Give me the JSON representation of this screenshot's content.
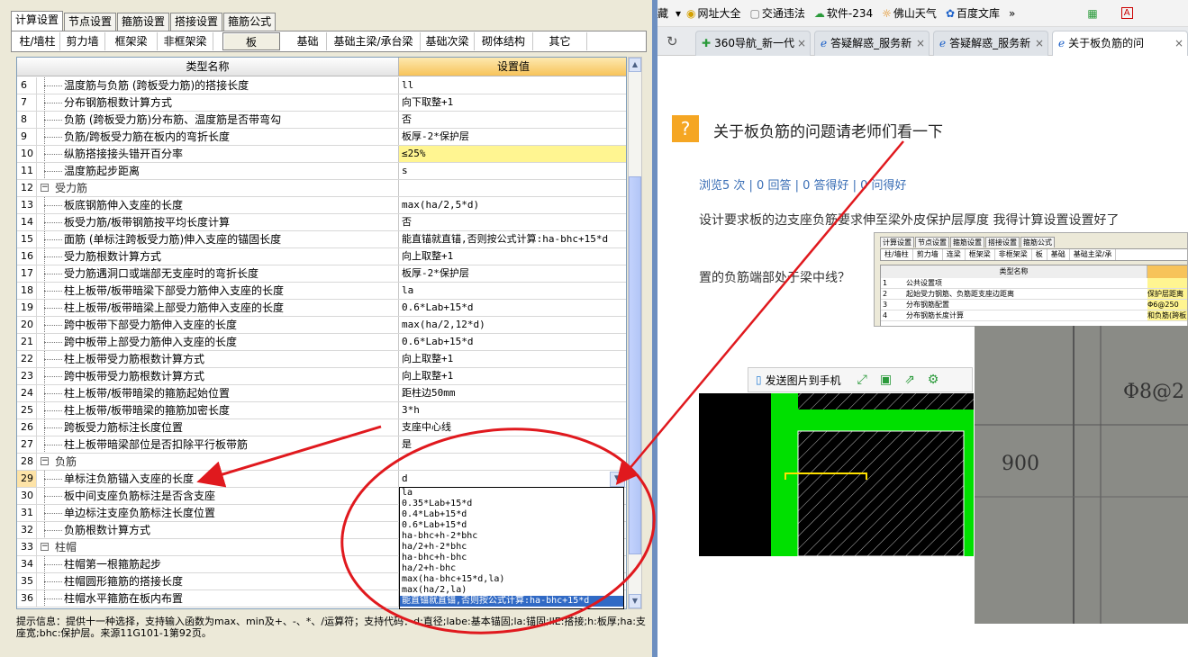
{
  "left_app": {
    "top_tabs": [
      "计算设置",
      "节点设置",
      "箍筋设置",
      "搭接设置",
      "箍筋公式"
    ],
    "top_tab_active": 0,
    "sub_tabs": [
      "柱/墙柱",
      "剪力墙",
      "框架梁",
      "非框架梁",
      "板",
      "基础",
      "基础主梁/承台梁",
      "基础次梁",
      "砌体结构",
      "其它"
    ],
    "sub_tab_active": 4,
    "grid": {
      "header_name": "类型名称",
      "header_value": "设置值",
      "rows": [
        {
          "n": "6",
          "name": "温度筋与负筋 (跨板受力筋)的搭接长度",
          "value": "ll",
          "type": "item"
        },
        {
          "n": "7",
          "name": "分布钢筋根数计算方式",
          "value": "向下取整+1",
          "type": "item"
        },
        {
          "n": "8",
          "name": "负筋 (跨板受力筋)分布筋、温度筋是否带弯勾",
          "value": "否",
          "type": "item"
        },
        {
          "n": "9",
          "name": "负筋/跨板受力筋在板内的弯折长度",
          "value": "板厚-2*保护层",
          "type": "item"
        },
        {
          "n": "10",
          "name": "纵筋搭接接头错开百分率",
          "value": "≤25%",
          "type": "item",
          "highlight": true
        },
        {
          "n": "11",
          "name": "温度筋起步距离",
          "value": "s",
          "type": "item"
        },
        {
          "n": "12",
          "name": "受力筋",
          "value": "",
          "type": "group"
        },
        {
          "n": "13",
          "name": "板底钢筋伸入支座的长度",
          "value": "max(ha/2,5*d)",
          "type": "item"
        },
        {
          "n": "14",
          "name": "板受力筋/板带钢筋按平均长度计算",
          "value": "否",
          "type": "item"
        },
        {
          "n": "15",
          "name": "面筋 (单标注跨板受力筋)伸入支座的锚固长度",
          "value": "能直锚就直锚,否则按公式计算:ha-bhc+15*d",
          "type": "item"
        },
        {
          "n": "16",
          "name": "受力筋根数计算方式",
          "value": "向上取整+1",
          "type": "item"
        },
        {
          "n": "17",
          "name": "受力筋遇洞口或端部无支座时的弯折长度",
          "value": "板厚-2*保护层",
          "type": "item"
        },
        {
          "n": "18",
          "name": "柱上板带/板带暗梁下部受力筋伸入支座的长度",
          "value": "la",
          "type": "item"
        },
        {
          "n": "19",
          "name": "柱上板带/板带暗梁上部受力筋伸入支座的长度",
          "value": "0.6*Lab+15*d",
          "type": "item"
        },
        {
          "n": "20",
          "name": "跨中板带下部受力筋伸入支座的长度",
          "value": "max(ha/2,12*d)",
          "type": "item"
        },
        {
          "n": "21",
          "name": "跨中板带上部受力筋伸入支座的长度",
          "value": "0.6*Lab+15*d",
          "type": "item"
        },
        {
          "n": "22",
          "name": "柱上板带受力筋根数计算方式",
          "value": "向上取整+1",
          "type": "item"
        },
        {
          "n": "23",
          "name": "跨中板带受力筋根数计算方式",
          "value": "向上取整+1",
          "type": "item"
        },
        {
          "n": "24",
          "name": "柱上板带/板带暗梁的箍筋起始位置",
          "value": "距柱边50mm",
          "type": "item"
        },
        {
          "n": "25",
          "name": "柱上板带/板带暗梁的箍筋加密长度",
          "value": "3*h",
          "type": "item"
        },
        {
          "n": "26",
          "name": "跨板受力筋标注长度位置",
          "value": "支座中心线",
          "type": "item"
        },
        {
          "n": "27",
          "name": "柱上板带暗梁部位是否扣除平行板带筋",
          "value": "是",
          "type": "item"
        },
        {
          "n": "28",
          "name": "负筋",
          "value": "",
          "type": "group"
        },
        {
          "n": "29",
          "name": "单标注负筋锚入支座的长度",
          "value": "d",
          "type": "item",
          "selected": true
        },
        {
          "n": "30",
          "name": "板中间支座负筋标注是否含支座",
          "value": "",
          "type": "item"
        },
        {
          "n": "31",
          "name": "单边标注支座负筋标注长度位置",
          "value": "",
          "type": "item"
        },
        {
          "n": "32",
          "name": "负筋根数计算方式",
          "value": "",
          "type": "item"
        },
        {
          "n": "33",
          "name": "柱帽",
          "value": "",
          "type": "group"
        },
        {
          "n": "34",
          "name": "柱帽第一根箍筋起步",
          "value": "",
          "type": "item"
        },
        {
          "n": "35",
          "name": "柱帽圆形箍筋的搭接长度",
          "value": "",
          "type": "item"
        },
        {
          "n": "36",
          "name": "柱帽水平箍筋在板内布置",
          "value": "",
          "type": "item"
        }
      ]
    },
    "dropdown_options": [
      "la",
      "0.35*Lab+15*d",
      "0.4*Lab+15*d",
      "0.6*Lab+15*d",
      "ha-bhc+h-2*bhc",
      "ha/2+h-2*bhc",
      "ha-bhc+h-bhc",
      "ha/2+h-bhc",
      "max(ha-bhc+15*d,la)",
      "max(ha/2,la)",
      "能直锚就直锚,否则按公式计算:ha-bhc+15*d"
    ],
    "dropdown_selected": 10,
    "hint": "提示信息：提供十一种选择，支持输入函数为max、min及+、-、*、/运算符；支持代码：d:直径;labe:基本锚固;la:锚固;llE:搭接;h:板厚;ha:支座宽;bhc:保护层。来源11G101-1第92页。"
  },
  "browser": {
    "bookmarks": [
      "藏",
      "网址大全",
      "交通违法",
      "软件-234",
      "佛山天气",
      "百度文库"
    ],
    "tabs": [
      "360导航_新一代",
      "答疑解惑_服务新",
      "答疑解惑_服务新",
      "关于板负筋的问"
    ],
    "active_tab": 3,
    "question_title": "关于板负筋的问题请老师们看一下",
    "stats": "浏览5 次 | 0 回答 | 0 答得好 | 0 问得好",
    "body_line1": "设计要求板的边支座负筋要求伸至梁外皮保护层厚度 我得计算设置设置好了",
    "body_line2": "置的负筋端部处于梁中线？",
    "image_toolbar_label": "发送图片到手机",
    "thumb": {
      "tabs": [
        "计算设置",
        "节点设置",
        "箍筋设置",
        "搭接设置",
        "箍筋公式"
      ],
      "subtabs": [
        "柱/墙柱",
        "剪力墙",
        "连梁",
        "框架梁",
        "非框架梁",
        "板",
        "基础",
        "基础主梁/承"
      ],
      "head": "类型名称",
      "rows": [
        {
          "n": "1",
          "name": "公共设置项",
          "value": ""
        },
        {
          "n": "2",
          "name": "起始受力钢筋、负筋距支座边距离",
          "value": "保护层距离"
        },
        {
          "n": "3",
          "name": "分布钢筋配置",
          "value": "Φ6@250"
        },
        {
          "n": "4",
          "name": "分布钢筋长度计算",
          "value": "和负筋(跨板"
        }
      ]
    },
    "photo_text": [
      "Φ8@2",
      "900"
    ]
  },
  "colors": {
    "annotation": "#e0191e",
    "header_orange": "#f7c35a",
    "highlight_yellow": "#fff591",
    "select_blue": "#316ac5",
    "accent": "#f5a623"
  }
}
